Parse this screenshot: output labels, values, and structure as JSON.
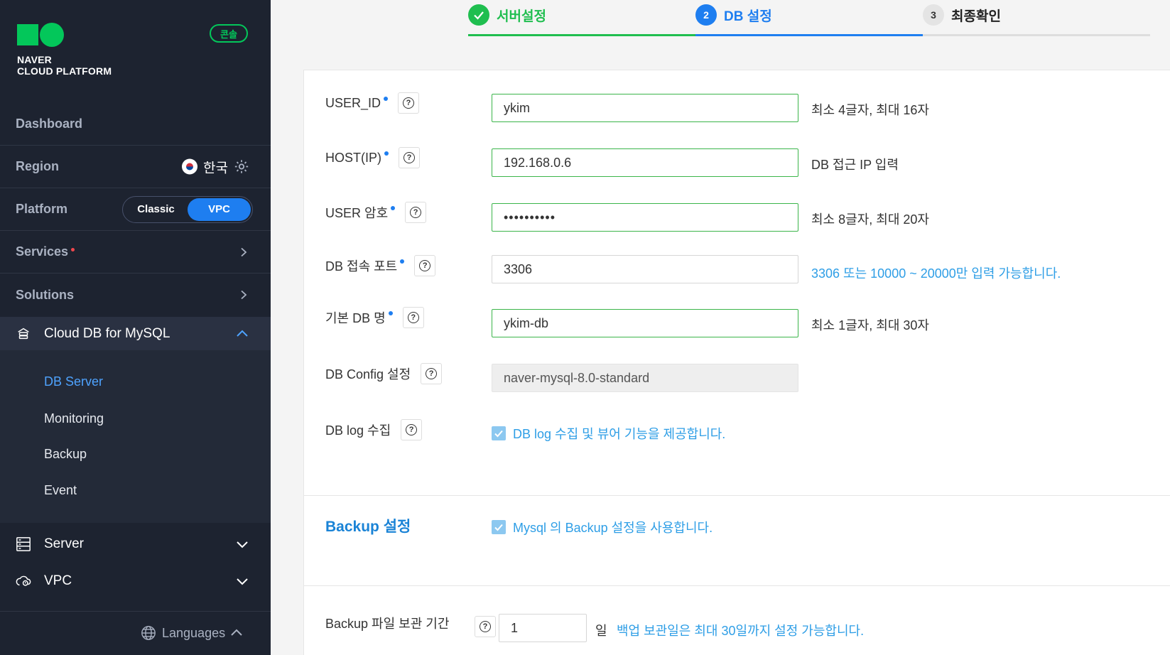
{
  "sidebar": {
    "logo_line1": "NAVER",
    "logo_line2": "CLOUD PLATFORM",
    "console_badge": "콘솔",
    "dashboard": "Dashboard",
    "region_label": "Region",
    "region_value": "한국",
    "platform_label": "Platform",
    "platform_options": [
      "Classic",
      "VPC"
    ],
    "platform_selected": "VPC",
    "services": "Services",
    "solutions": "Solutions",
    "active_menu": "Cloud DB for MySQL",
    "sub_items": [
      "DB Server",
      "Monitoring",
      "Backup",
      "Event"
    ],
    "active_sub": "DB Server",
    "server": "Server",
    "vpc": "VPC",
    "languages": "Languages"
  },
  "steps": [
    {
      "num": "",
      "label": "서버설정",
      "state": "done"
    },
    {
      "num": "2",
      "label": "DB 설정",
      "state": "active"
    },
    {
      "num": "3",
      "label": "최종확인",
      "state": "pending"
    }
  ],
  "form": {
    "user_id": {
      "label": "USER_ID",
      "value": "ykim",
      "hint": "최소 4글자, 최대 16자"
    },
    "host_ip": {
      "label": "HOST(IP)",
      "value": "192.168.0.6",
      "hint": "DB 접근 IP 입력"
    },
    "user_pw": {
      "label": "USER 암호",
      "value": "••••••••••",
      "hint": "최소 8글자, 최대 20자"
    },
    "db_port": {
      "label": "DB 접속 포트",
      "value": "3306",
      "hint": "3306 또는 10000 ~ 20000만 입력 가능합니다."
    },
    "db_name": {
      "label": "기본 DB 명",
      "value": "ykim-db",
      "hint": "최소 1글자, 최대 30자"
    },
    "db_config": {
      "label": "DB Config 설정",
      "value": "naver-mysql-8.0-standard"
    },
    "db_log": {
      "label": "DB log 수집",
      "check_label": "DB log 수집 및 뷰어 기능을 제공합니다."
    },
    "backup_section": {
      "title": "Backup 설정",
      "check_label": "Mysql 의 Backup 설정을 사용합니다."
    },
    "backup_retention": {
      "label": "Backup 파일 보관 기간",
      "value": "1",
      "unit": "일",
      "hint": "백업 보관일은 최대 30일까지 설정 가능합니다."
    }
  },
  "colors": {
    "accent_green": "#03c75a",
    "accent_blue": "#1e7ef0",
    "sidebar_bg": "#1d2330"
  }
}
